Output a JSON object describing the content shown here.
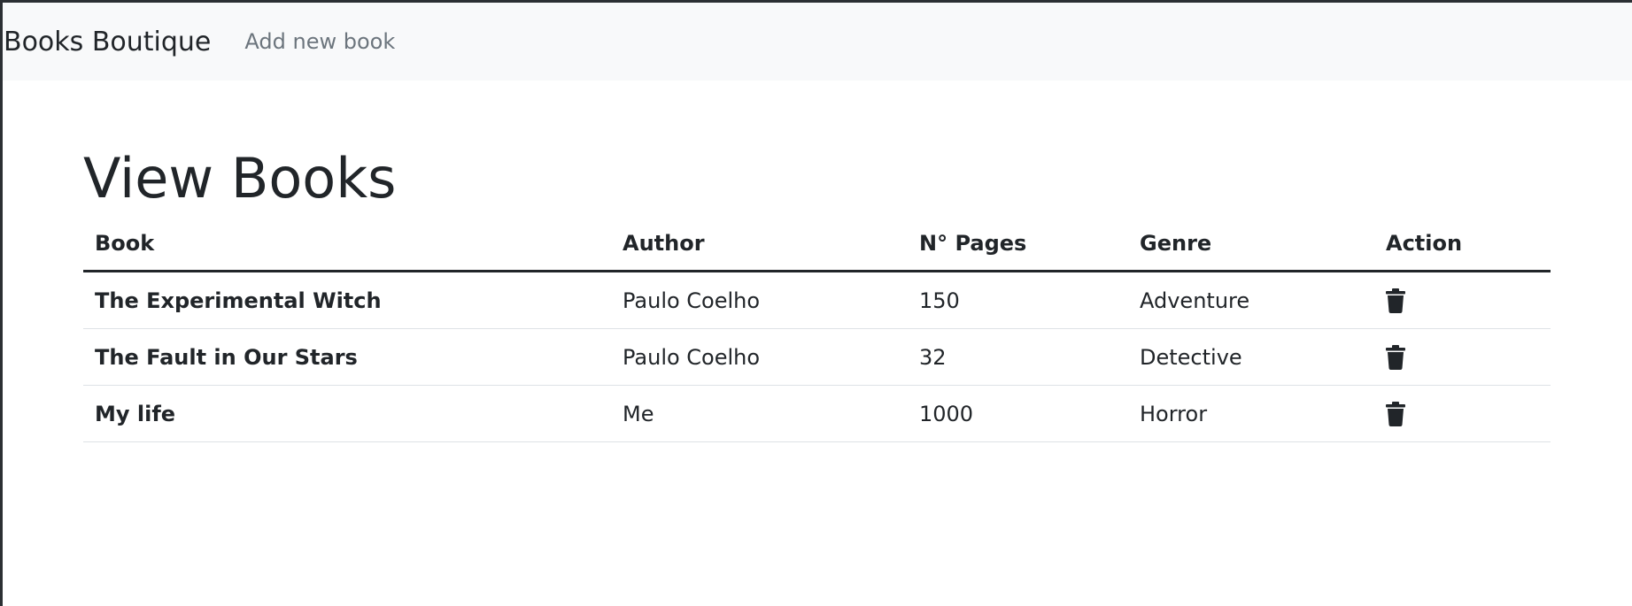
{
  "navbar": {
    "brand": "Books Boutique",
    "links": [
      {
        "label": "Add new book"
      }
    ]
  },
  "page": {
    "title": "View Books"
  },
  "table": {
    "columns": [
      "Book",
      "Author",
      "N° Pages",
      "Genre",
      "Action"
    ],
    "rows": [
      {
        "book": "The Experimental Witch",
        "author": "Paulo Coelho",
        "pages": "150",
        "genre": "Adventure",
        "action_icon": "trash-icon"
      },
      {
        "book": "The Fault in Our Stars",
        "author": "Paulo Coelho",
        "pages": "32",
        "genre": "Detective",
        "action_icon": "trash-icon"
      },
      {
        "book": "My life",
        "author": "Me",
        "pages": "1000",
        "genre": "Horror",
        "action_icon": "trash-icon"
      }
    ]
  },
  "colors": {
    "text": "#212529",
    "muted": "#6c757d",
    "navbar_bg": "#f8f9fa",
    "row_border": "#dee2e6"
  }
}
